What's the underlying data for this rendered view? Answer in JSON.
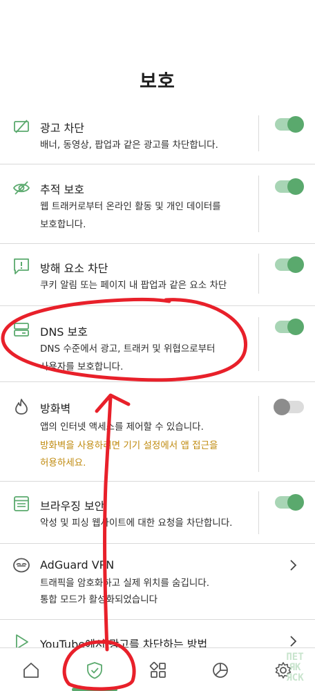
{
  "page": {
    "title": "보호"
  },
  "rows": {
    "ad_block": {
      "title": "광고 차단",
      "desc": "배너, 동영상, 팝업과 같은 광고를 차단합니다.",
      "enabled": true,
      "icon": "ad-block-icon"
    },
    "tracking": {
      "title": "추적 보호",
      "desc_line1": "웹 트래커로부터 온라인 활동 및 개인 데이터를",
      "desc_line2": "보호합니다.",
      "enabled": true,
      "icon": "eye-off-icon"
    },
    "annoyance": {
      "title": "방해 요소 차단",
      "desc": "쿠키 알림 또는 페이지 내 팝업과 같은 요소 차단",
      "enabled": true,
      "icon": "alert-message-icon"
    },
    "dns": {
      "title": "DNS 보호",
      "desc_line1": "DNS 수준에서 광고, 트래커 및 위협으로부터",
      "desc_line2": "사용자를 보호합니다.",
      "enabled": true,
      "icon": "server-icon"
    },
    "firewall": {
      "title": "방화벽",
      "desc": "앱의 인터넷 액세스를 제어할 수 있습니다.",
      "warn_line1": "방화벽을 사용하려면 기기 설정에서 앱 접근을",
      "warn_line2": "허용하세요.",
      "enabled": false,
      "icon": "flame-icon"
    },
    "browsing": {
      "title": "브라우징 보안",
      "desc": "악성 및 피싱 웹사이트에 대한 요청을 차단합니다.",
      "enabled": true,
      "icon": "browser-icon"
    },
    "vpn": {
      "title": "AdGuard VPN",
      "desc_line1": "트래픽을 암호화하고 실제 위치를 숨깁니다.",
      "desc_line2": "통합 모드가 활성화되었습니다",
      "icon": "vpn-mask-icon"
    },
    "youtube": {
      "title": "YouTube에서 광고를 차단하는 방법",
      "icon": "play-icon"
    }
  },
  "bottom_nav": {
    "items": [
      "home-icon",
      "shield-check-icon",
      "apps-grid-icon",
      "pie-chart-icon",
      "settings-gear-icon"
    ],
    "active_index": 1
  },
  "watermark": {
    "line1": "ПЕТ",
    "line2": "ЯК",
    "line3": "ЯСК"
  },
  "colors": {
    "accent": "#5aa96d",
    "toggle_track_on": "#a8d5b5",
    "warning": "#c08b10",
    "annotation": "#e8202a"
  }
}
